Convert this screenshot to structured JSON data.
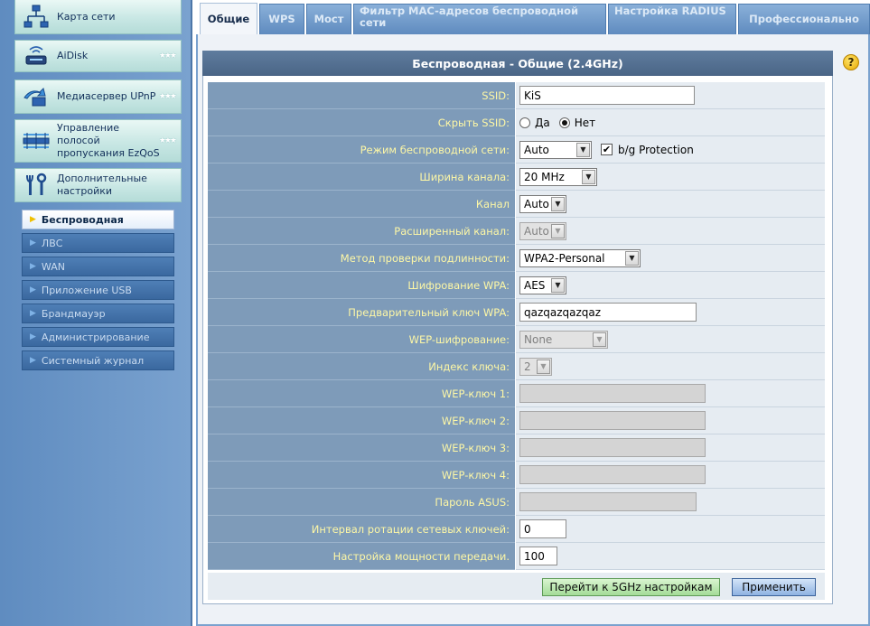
{
  "sidebar": {
    "main_items": [
      {
        "label": "Карта сети",
        "icon": "network-map-icon"
      },
      {
        "label": "AiDisk",
        "icon": "aidisk-icon"
      },
      {
        "label": "Медиасервер UPnP",
        "icon": "media-server-icon"
      },
      {
        "label": "Управление полосой пропускания EzQoS",
        "icon": "ezqos-icon"
      },
      {
        "label": "Дополнительные настройки",
        "icon": "tools-icon"
      }
    ],
    "sub_items": [
      {
        "label": "Беспроводная",
        "active": true
      },
      {
        "label": "ЛВС"
      },
      {
        "label": "WAN"
      },
      {
        "label": "Приложение USB"
      },
      {
        "label": "Брандмауэр"
      },
      {
        "label": "Администрирование"
      },
      {
        "label": "Системный журнал"
      }
    ]
  },
  "tabs": [
    {
      "label": "Общие",
      "active": true
    },
    {
      "label": "WPS"
    },
    {
      "label": "Мост"
    },
    {
      "label": "Фильтр MAC-адресов беспроводной сети"
    },
    {
      "label": "Настройка RADIUS"
    },
    {
      "label": "Профессионально"
    }
  ],
  "section": {
    "title": "Беспроводная - Общие (2.4GHz)"
  },
  "form": {
    "ssid": {
      "label": "SSID:",
      "value": "KiS"
    },
    "hide_ssid": {
      "label": "Скрыть SSID:",
      "yes": "Да",
      "no": "Нет",
      "selected": "no"
    },
    "wireless_mode": {
      "label": "Режим беспроводной сети:",
      "value": "Auto",
      "protection_label": "b/g Protection",
      "protection_checked": true
    },
    "channel_width": {
      "label": "Ширина канала:",
      "value": "20 MHz"
    },
    "channel": {
      "label": "Канал",
      "value": "Auto"
    },
    "ext_channel": {
      "label": "Расширенный канал:",
      "value": "Auto"
    },
    "auth_method": {
      "label": "Метод проверки подлинности:",
      "value": "WPA2-Personal"
    },
    "wpa_encryption": {
      "label": "Шифрование WPA:",
      "value": "AES"
    },
    "wpa_key": {
      "label": "Предварительный ключ WPA:",
      "value": "qazqazqazqaz"
    },
    "wep_encryption": {
      "label": "WEP-шифрование:",
      "value": "None"
    },
    "key_index": {
      "label": "Индекс ключа:",
      "value": "2"
    },
    "wep_key1": {
      "label": "WEP-ключ 1:",
      "value": ""
    },
    "wep_key2": {
      "label": "WEP-ключ 2:",
      "value": ""
    },
    "wep_key3": {
      "label": "WEP-ключ 3:",
      "value": ""
    },
    "wep_key4": {
      "label": "WEP-ключ 4:",
      "value": ""
    },
    "asus_passphrase": {
      "label": "Пароль ASUS:",
      "value": ""
    },
    "key_rotation": {
      "label": "Интервал ротации сетевых ключей:",
      "value": "0"
    },
    "tx_power": {
      "label": "Настройка мощности передачи.",
      "value": "100"
    }
  },
  "buttons": {
    "goto_5ghz": "Перейти к 5GHz настройкам",
    "apply": "Применить"
  },
  "help_icon": "?",
  "colors": {
    "label_text": "#fdf7a6",
    "label_bg": "#7e9bb9",
    "header_bg": "#4a6586"
  }
}
